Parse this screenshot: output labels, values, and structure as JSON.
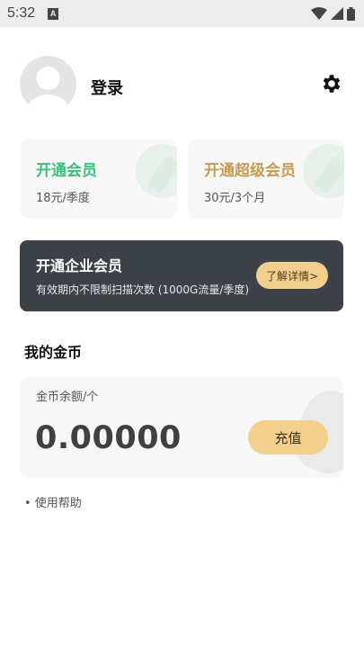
{
  "status_bar": {
    "time": "5:32",
    "notification": "A"
  },
  "profile": {
    "login_label": "登录"
  },
  "vip": {
    "member": {
      "title": "开通会员",
      "price": "18元/季度",
      "color": "#3cbf7c"
    },
    "super_member": {
      "title": "开通超级会员",
      "price": "30元/3个月",
      "color": "#c89a56"
    }
  },
  "enterprise": {
    "title": "开通企业会员",
    "description": "有效期内不限制扫描次数 (1000G流量/季度)",
    "details_button": "了解详情>"
  },
  "coins": {
    "section_title": "我的金币",
    "balance_label": "金币余额/个",
    "balance_value": "0.00000",
    "recharge_button": "充值"
  },
  "help": {
    "label": "• 使用帮助"
  },
  "colors": {
    "accent_gold": "#f3cf8e",
    "dark_card": "#3d4249"
  }
}
